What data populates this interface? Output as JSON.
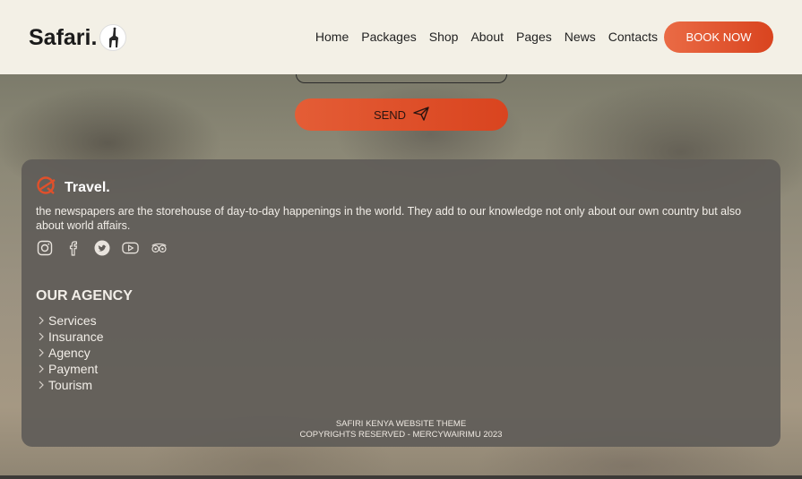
{
  "header": {
    "logo_text": "Safari.",
    "nav": [
      "Home",
      "Packages",
      "Shop",
      "About",
      "Pages",
      "News",
      "Contacts"
    ],
    "book_label": "BOOK NOW"
  },
  "form": {
    "send_label": "SEND"
  },
  "footer": {
    "brand": "Travel.",
    "description": "the newspapers are the storehouse of day-to-day happenings in the world. They add to our knowledge not only about our own country but also about world affairs.",
    "socials": [
      "instagram-icon",
      "facebook-icon",
      "twitter-icon",
      "youtube-icon",
      "tripadvisor-icon"
    ],
    "agency_title": "OUR AGENCY",
    "agency_items": [
      "Services",
      "Insurance",
      "Agency",
      "Payment",
      "Tourism"
    ],
    "copyright_line1": "SAFIRI KENYA WEBSITE THEME",
    "copyright_line2": "COPYRIGHTS RESERVED - MERCYWAIRIMU 2023"
  },
  "colors": {
    "accent": "#e0502b",
    "header_bg": "#f3f0e6",
    "card_bg": "#605c58"
  }
}
